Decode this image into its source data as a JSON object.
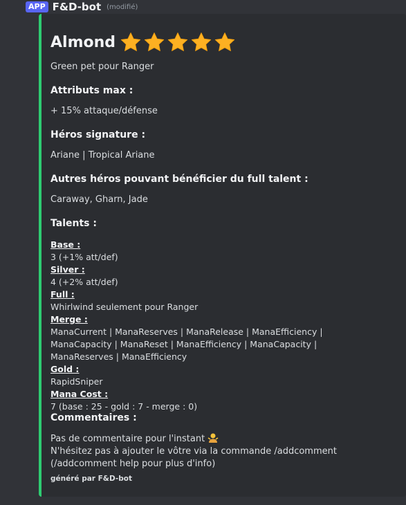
{
  "header": {
    "badge": "APP",
    "bot_name": "F&D-bot",
    "edited": "(modifié)"
  },
  "embed": {
    "accent_color": "#2ecc71",
    "title": "Almond",
    "rating_stars": 5,
    "description": "Green pet pour Ranger",
    "fields": {
      "attributes": {
        "name": "Attributs max :",
        "value": "+ 15% attaque/défense"
      },
      "signature": {
        "name": "Héros signature :",
        "value": "Ariane | Tropical Ariane"
      },
      "others": {
        "name": "Autres héros pouvant bénéficier du full talent :",
        "value": "Caraway, Gharn, Jade"
      },
      "talents": {
        "name": "Talents :",
        "items": [
          {
            "label": "Base :",
            "value": "3 (+1% att/def)"
          },
          {
            "label": "Silver :",
            "value": "4 (+2% att/def)"
          },
          {
            "label": "Full :",
            "value": "Whirlwind seulement pour Ranger"
          },
          {
            "label": "Merge :",
            "value": "ManaCurrent | ManaReserves | ManaRelease | ManaEfficiency | ManaCapacity | ManaReset | ManaEfficiency | ManaCapacity | ManaReserves | ManaEfficiency"
          },
          {
            "label": "Gold :",
            "value": "RapidSniper"
          },
          {
            "label": "Mana Cost :",
            "value": "7 (base : 25 - gold : 7 - merge : 0)"
          }
        ]
      },
      "comments": {
        "name": "Commentaires :",
        "line1": "Pas de commentaire pour l'instant",
        "line2": "N'hésitez pas à ajouter le vôtre via la commande /addcomment (/addcomment help pour plus d'info)"
      }
    },
    "footer": "généré par F&D-bot"
  }
}
